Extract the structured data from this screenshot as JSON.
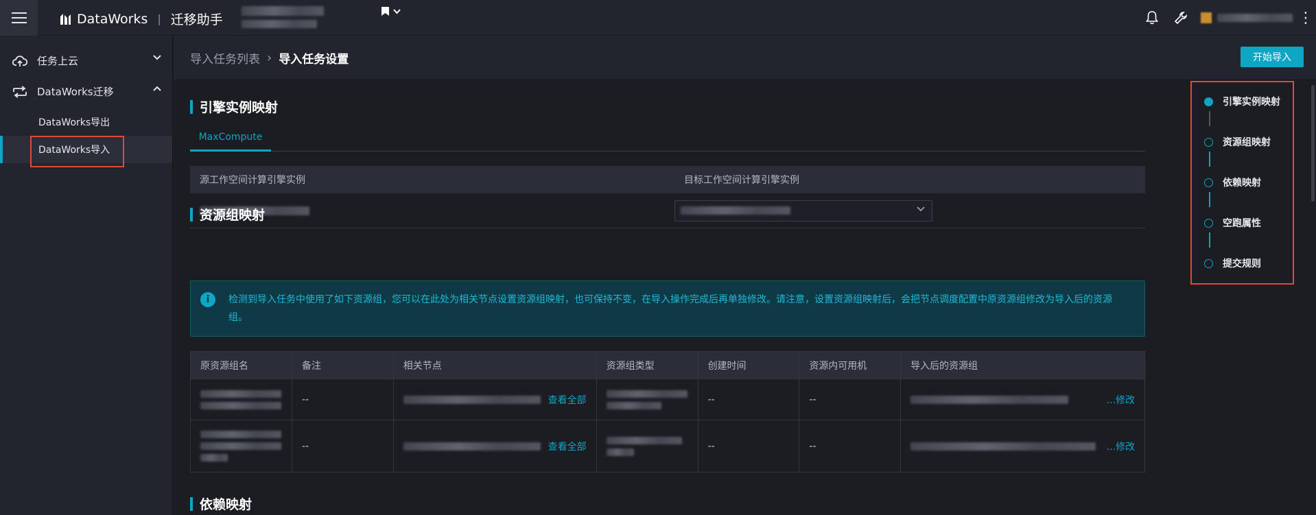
{
  "header": {
    "brand": "DataWorks",
    "module": "迁移助手",
    "icons": [
      "menu-icon",
      "bookmark-icon",
      "bell-icon",
      "wrench-icon",
      "more-icon"
    ]
  },
  "sidebar": {
    "groups": [
      {
        "label": "任务上云",
        "icon": "cloud-upload-icon",
        "expanded": false
      },
      {
        "label": "DataWorks迁移",
        "icon": "migrate-icon",
        "expanded": true,
        "items": [
          {
            "label": "DataWorks导出",
            "active": false
          },
          {
            "label": "DataWorks导入",
            "active": true
          }
        ]
      }
    ]
  },
  "breadcrumb": {
    "parent": "导入任务列表",
    "current": "导入任务设置"
  },
  "actions": {
    "start_import": "开始导入"
  },
  "sections": {
    "engine": {
      "title": "引擎实例映射",
      "tab": "MaxCompute",
      "col_source": "源工作空间计算引擎实例",
      "col_target": "目标工作空间计算引擎实例"
    },
    "resource": {
      "title": "资源组映射",
      "notice": "检测到导入任务中使用了如下资源组，您可以在此处为相关节点设置资源组映射，也可保持不变，在导入操作完成后再单独修改。请注意，设置资源组映射后，会把节点调度配置中原资源组修改为导入后的资源组。",
      "columns": [
        "原资源组名",
        "备注",
        "相关节点",
        "资源组类型",
        "创建时间",
        "资源内可用机",
        "导入后的资源组"
      ],
      "rows": [
        {
          "remark": "--",
          "view_all": "查看全部",
          "created": "--",
          "machines": "--",
          "modify": "...修改"
        },
        {
          "remark": "--",
          "view_all": "查看全部",
          "created": "--",
          "machines": "--",
          "modify": "...修改"
        }
      ]
    },
    "dependency": {
      "title": "依赖映射"
    }
  },
  "anchors": [
    {
      "label": "引擎实例映射",
      "active": true
    },
    {
      "label": "资源组映射",
      "active": false
    },
    {
      "label": "依赖映射",
      "active": false
    },
    {
      "label": "空跑属性",
      "active": false
    },
    {
      "label": "提交规则",
      "active": false
    }
  ],
  "colors": {
    "accent": "#0fa5c5",
    "highlight_box": "#e5483b",
    "background": "#1b1d23",
    "panel": "#23252e"
  }
}
